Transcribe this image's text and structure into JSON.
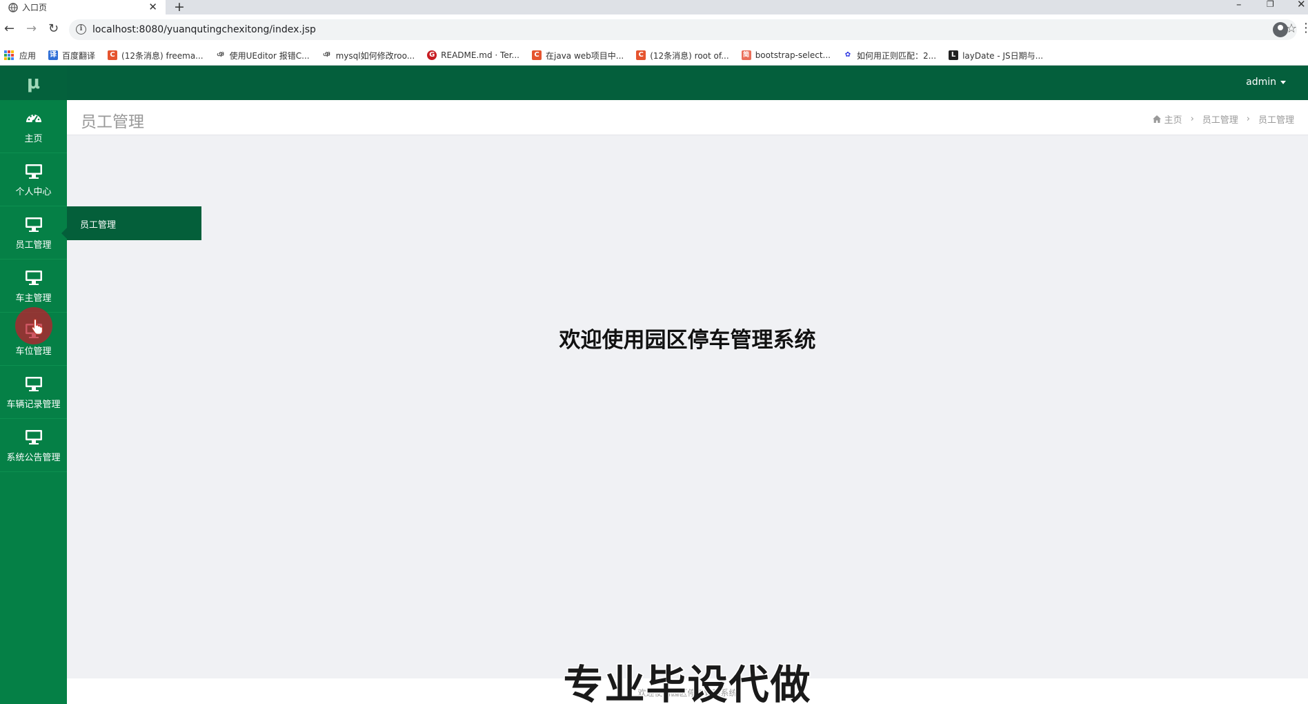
{
  "browser": {
    "tab_title": "入口页",
    "tab_close": "✕",
    "new_tab": "+",
    "url": "localhost:8080/yuanqutingchexitong/index.jsp",
    "bookmarks": [
      {
        "label": "应用",
        "icon": "apps-icon"
      },
      {
        "label": "百度翻译",
        "icon": "baidu-translate-icon",
        "color": "#2f6fd6",
        "glyph": "译"
      },
      {
        "label": "(12条消息) freema...",
        "icon": "csdn-icon",
        "color": "#e5542f",
        "glyph": "C"
      },
      {
        "label": "使用UEditor 报错C...",
        "icon": "cnblogs-icon",
        "color": "#ffffff",
        "glyph": "ঞ"
      },
      {
        "label": "mysql如何修改roo...",
        "icon": "cnblogs-icon",
        "color": "#ffffff",
        "glyph": "ঞ"
      },
      {
        "label": "README.md · Ter...",
        "icon": "gitee-icon",
        "color": "#c71d23",
        "glyph": "G"
      },
      {
        "label": "在java web项目中...",
        "icon": "csdn-icon",
        "color": "#e5542f",
        "glyph": "C"
      },
      {
        "label": "(12条消息) root of...",
        "icon": "csdn-icon",
        "color": "#e5542f",
        "glyph": "C"
      },
      {
        "label": "bootstrap-select...",
        "icon": "jianshu-icon",
        "color": "#ea6f5a",
        "glyph": "简"
      },
      {
        "label": "如何用正则匹配：2...",
        "icon": "baidu-paw-icon",
        "color": "#2932e1",
        "glyph": "✿"
      },
      {
        "label": "layDate - JS日期与...",
        "icon": "layui-icon",
        "color": "#222222",
        "glyph": "L"
      }
    ]
  },
  "app": {
    "logo": "μ",
    "user": "admin",
    "page_title": "员工管理",
    "breadcrumb": [
      "主页",
      "员工管理",
      "员工管理"
    ],
    "sidebar": [
      {
        "label": "主页",
        "icon": "dashboard-icon"
      },
      {
        "label": "个人中心",
        "icon": "monitor-icon"
      },
      {
        "label": "员工管理",
        "icon": "monitor-icon"
      },
      {
        "label": "车主管理",
        "icon": "monitor-icon"
      },
      {
        "label": "车位管理",
        "icon": "monitor-icon"
      },
      {
        "label": "车辆记录管理",
        "icon": "monitor-icon"
      },
      {
        "label": "系统公告管理",
        "icon": "monitor-icon"
      }
    ],
    "active_menu": "员工管理",
    "submenu": [
      "员工管理"
    ],
    "welcome": "欢迎使用园区停车管理系统",
    "footer": "欢迎使用园区停车管理系统",
    "watermark": "专业毕设代做",
    "colors": {
      "sidebar": "#058046",
      "topbar": "#045f3c",
      "submenu": "#045f3a",
      "content_bg": "#f0f1f4"
    }
  }
}
